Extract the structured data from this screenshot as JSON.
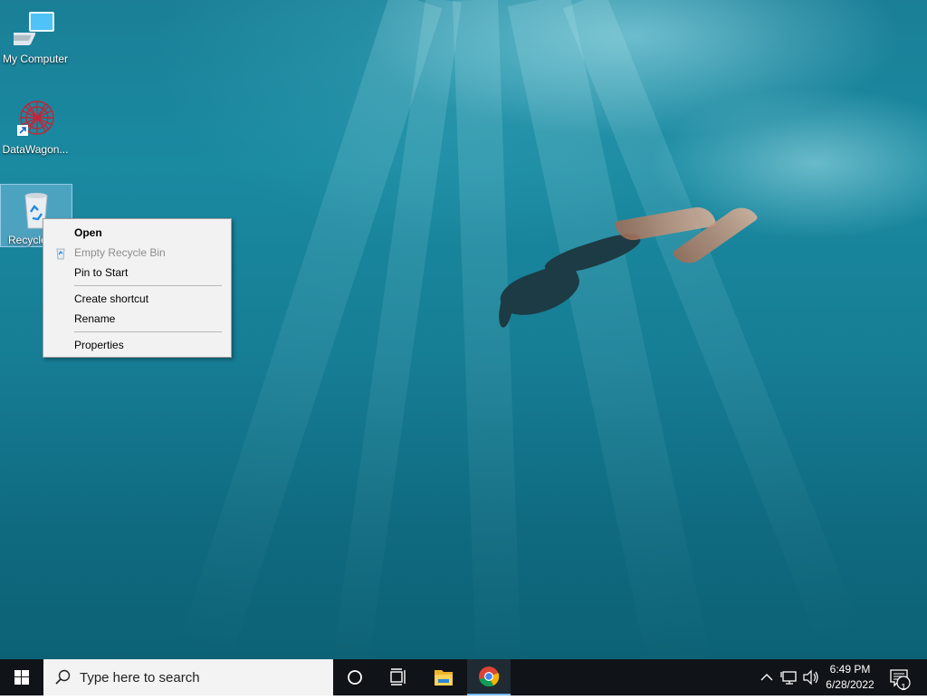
{
  "desktop": {
    "icons": [
      {
        "label": "My Computer",
        "icon": "computer-icon"
      },
      {
        "label": "DataWagon...",
        "icon": "datawagon-icon"
      },
      {
        "label": "Recycle Bin",
        "icon": "recycle-bin-icon"
      }
    ]
  },
  "context_menu": {
    "items": [
      {
        "label": "Open",
        "bold": true,
        "enabled": true
      },
      {
        "label": "Empty Recycle Bin",
        "enabled": false,
        "icon": "recycle-small-icon"
      },
      {
        "label": "Pin to Start",
        "enabled": true
      },
      {
        "label": "Create shortcut",
        "enabled": true
      },
      {
        "label": "Rename",
        "enabled": true
      },
      {
        "label": "Properties",
        "enabled": true
      }
    ]
  },
  "taskbar": {
    "search_placeholder": "Type here to search",
    "pinned": [
      "cortana-icon",
      "task-view-icon",
      "file-explorer-icon",
      "chrome-icon"
    ],
    "clock": {
      "time": "6:49 PM",
      "date": "6/28/2022"
    },
    "notifications_count": "1"
  },
  "colors": {
    "taskbar_bg": "#101418",
    "menu_bg": "#f2f2f2",
    "accent": "#0078d7"
  }
}
